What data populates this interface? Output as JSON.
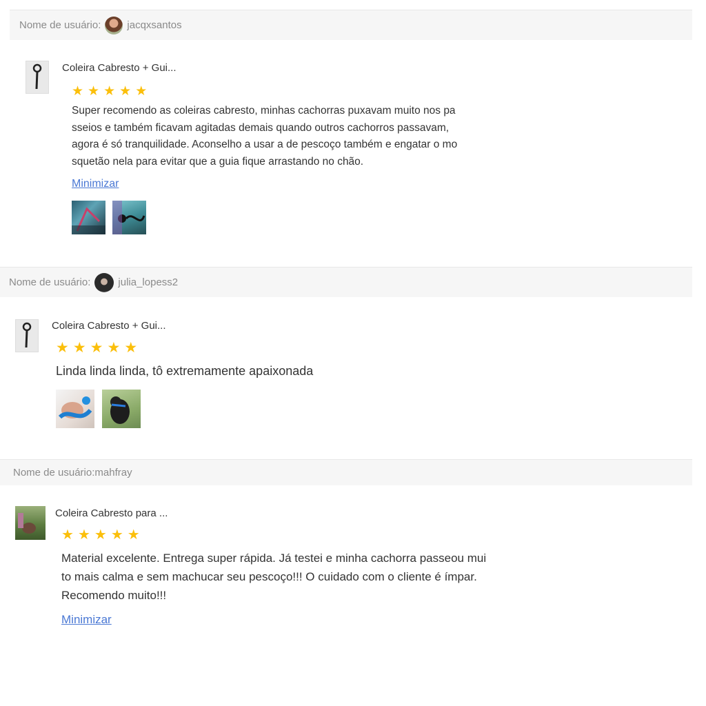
{
  "colors": {
    "star": "#fbbf0b",
    "link": "#4a78d4",
    "user_bar_bg": "#f6f6f6",
    "muted_text": "#8a8a8a"
  },
  "icons": {
    "star": "star-icon"
  },
  "reviews": [
    {
      "user_label": "Nome de usuário:",
      "username": "jacqxsantos",
      "product_name": "Coleira Cabresto + Gui...",
      "rating": 5,
      "text": "Super recomendo as coleiras cabresto, minhas cachorras puxavam muito nos pa\nsseios e também ficavam agitadas demais quando outros cachorros passavam,\nagora é só tranquilidade. Aconselho a usar a de pescoço também e engatar o mo\nsquetão nela para evitar que a guia fique arrastando no chão.",
      "toggle_label": "Minimizar",
      "photos": 2
    },
    {
      "user_label": "Nome de usuário:",
      "username": "julia_lopess2",
      "product_name": "Coleira Cabresto + Gui...",
      "rating": 5,
      "text": "Linda linda linda, tô extremamente apaixonada",
      "photos": 2
    },
    {
      "user_label": "Nome de usuário:mahfray",
      "product_name": "Coleira Cabresto para ...",
      "rating": 5,
      "text": "Material excelente. Entrega super rápida. Já testei e minha cachorra passeou mui\nto mais calma e sem machucar seu pescoço!!! O cuidado com o cliente é ímpar.\nRecomendo muito!!!",
      "toggle_label": "Minimizar"
    }
  ]
}
